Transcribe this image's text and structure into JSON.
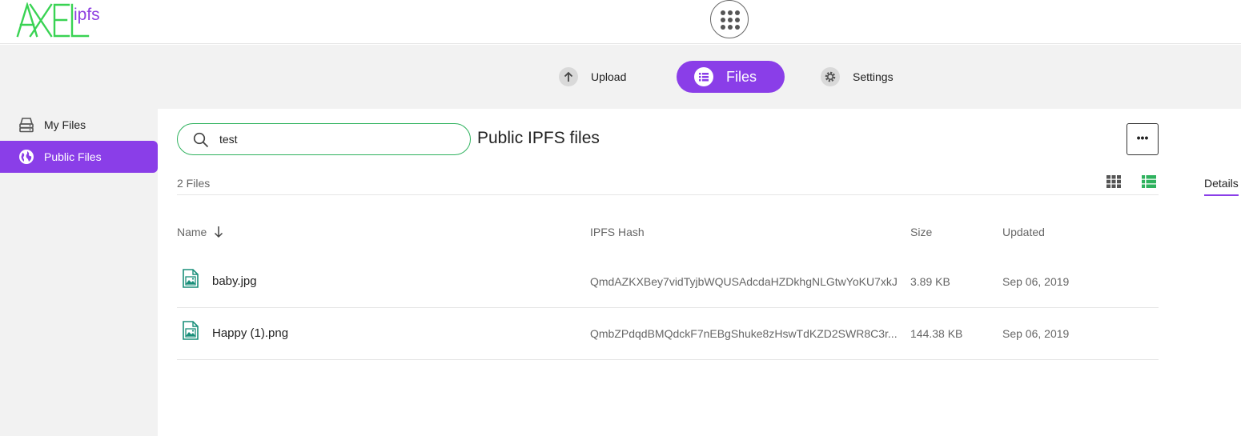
{
  "brand": {
    "logo_text": "AXEL",
    "product": "ipfs",
    "logo_color": "#39d353",
    "accent": "#8a3ee8"
  },
  "header": {
    "apps_icon": "apps-grid-icon"
  },
  "nav": {
    "upload_label": "Upload",
    "files_label": "Files",
    "settings_label": "Settings"
  },
  "sidebar": {
    "items": [
      {
        "label": "My Files",
        "icon": "drive-stack-icon",
        "active": false
      },
      {
        "label": "Public Files",
        "icon": "globe-icon",
        "active": true
      }
    ]
  },
  "search": {
    "value": "test",
    "placeholder": ""
  },
  "main": {
    "title": "Public IPFS files",
    "more_label": "•••",
    "file_count": "2 Files",
    "details_tab": "Details",
    "columns": {
      "name": "Name",
      "hash": "IPFS Hash",
      "size": "Size",
      "updated": "Updated"
    },
    "sort": {
      "column": "name",
      "direction": "descending"
    },
    "view_mode": "list",
    "files": [
      {
        "name": "baby.jpg",
        "hash": "QmdAZKXBey7vidTyjbWQUSAdcdaHZDkhgNLGtwYoKU7xkJ",
        "size": "3.89 KB",
        "updated": "Sep 06, 2019"
      },
      {
        "name": "Happy (1).png",
        "hash": "QmbZPdqdBMQdckF7nEBgShuke8zHswTdKZD2SWR8C3r...",
        "size": "144.38 KB",
        "updated": "Sep 06, 2019"
      }
    ]
  }
}
